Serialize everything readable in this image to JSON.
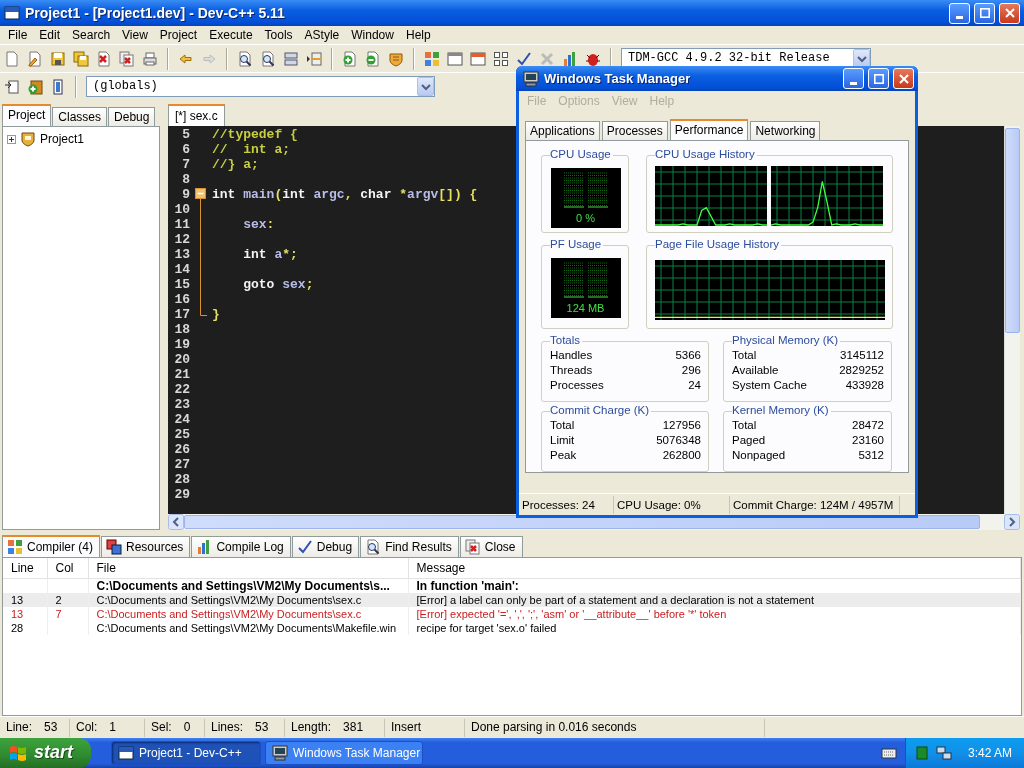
{
  "window": {
    "title": "Project1 - [Project1.dev] - Dev-C++ 5.11"
  },
  "menu": [
    {
      "label": "File"
    },
    {
      "label": "Edit"
    },
    {
      "label": "Search"
    },
    {
      "label": "View"
    },
    {
      "label": "Project"
    },
    {
      "label": "Execute"
    },
    {
      "label": "Tools"
    },
    {
      "label": "AStyle"
    },
    {
      "label": "Window"
    },
    {
      "label": "Help"
    }
  ],
  "compiler_field": {
    "value": "TDM-GCC 4.9.2 32-bit Release"
  },
  "scope_field": {
    "value": "(globals)"
  },
  "side_tabs": [
    {
      "label": "Project",
      "selected": true
    },
    {
      "label": "Classes",
      "selected": false
    },
    {
      "label": "Debug",
      "selected": false
    }
  ],
  "project_tree": [
    {
      "label": "Project1",
      "expanded": false
    }
  ],
  "editor_tabs": [
    {
      "label": "[*] sex.c",
      "selected": true
    }
  ],
  "code_lines": [
    {
      "number": "5",
      "tokens": [
        {
          "text": "//typedef {",
          "kind": "comment"
        }
      ]
    },
    {
      "number": "6",
      "tokens": [
        {
          "text": "//  int a;",
          "kind": "comment"
        }
      ]
    },
    {
      "number": "7",
      "tokens": [
        {
          "text": "//} a;",
          "kind": "comment"
        }
      ]
    },
    {
      "number": "8"
    },
    {
      "number": "9",
      "kind": "fold_start",
      "tokens": [
        {
          "text": "int",
          "kind": "keyword"
        },
        {
          "text": " main",
          "kind": "identifier"
        },
        {
          "text": "(",
          "kind": "symbol"
        },
        {
          "text": "int",
          "kind": "keyword"
        },
        {
          "text": " argc",
          "kind": "identifier"
        },
        {
          "text": ",",
          "kind": "symbol"
        },
        {
          "text": " char",
          "kind": "keyword"
        },
        {
          "text": " *",
          "kind": "symbol"
        },
        {
          "text": "argv",
          "kind": "identifier"
        },
        {
          "text": "[])",
          "kind": "symbol"
        },
        {
          "text": " {",
          "kind": "symbol"
        }
      ]
    },
    {
      "number": "10",
      "kind": "fold_body"
    },
    {
      "number": "11",
      "kind": "fold_body",
      "tokens": [
        {
          "text": "    sex",
          "kind": "identifier"
        },
        {
          "text": ":",
          "kind": "symbol"
        }
      ]
    },
    {
      "number": "12",
      "kind": "fold_body"
    },
    {
      "number": "13",
      "kind": "fold_body",
      "tokens": [
        {
          "text": "    int",
          "kind": "keyword"
        },
        {
          "text": " a",
          "kind": "identifier"
        },
        {
          "text": "*;",
          "kind": "symbol"
        }
      ]
    },
    {
      "number": "14",
      "kind": "fold_body"
    },
    {
      "number": "15",
      "kind": "fold_body",
      "tokens": [
        {
          "text": "    goto",
          "kind": "keyword"
        },
        {
          "text": " sex",
          "kind": "identifier"
        },
        {
          "text": ";",
          "kind": "symbol"
        }
      ]
    },
    {
      "number": "16",
      "kind": "fold_body"
    },
    {
      "number": "17",
      "kind": "fold_end",
      "tokens": [
        {
          "text": "}",
          "kind": "symbol"
        }
      ]
    },
    {
      "number": "18"
    },
    {
      "number": "19"
    },
    {
      "number": "20"
    },
    {
      "number": "21"
    },
    {
      "number": "22"
    },
    {
      "number": "23"
    },
    {
      "number": "24"
    },
    {
      "number": "25"
    },
    {
      "number": "26"
    },
    {
      "number": "27"
    },
    {
      "number": "28"
    },
    {
      "number": "29"
    }
  ],
  "output_tabs": [
    {
      "label": "Compiler (4)",
      "kind": "compiler",
      "selected": true
    },
    {
      "label": "Resources",
      "kind": "resources",
      "selected": false
    },
    {
      "label": "Compile Log",
      "kind": "log",
      "selected": false
    },
    {
      "label": "Debug",
      "kind": "debug",
      "selected": false
    },
    {
      "label": "Find Results",
      "kind": "find",
      "selected": false
    },
    {
      "label": "Close",
      "kind": "close",
      "selected": false
    }
  ],
  "output_table": {
    "columns": [
      "Line",
      "Col",
      "File",
      "Message"
    ],
    "rows": [
      {
        "kind": "header",
        "selected": false,
        "file": "C:\\Documents and Settings\\VM2\\My Documents\\s...",
        "message": "In function 'main':"
      },
      {
        "kind": "normal",
        "selected": true,
        "line": "13",
        "col": "2",
        "file": "C:\\Documents and Settings\\VM2\\My Documents\\sex.c",
        "message": "[Error] a label can only be part of a statement and a declaration is not a statement"
      },
      {
        "kind": "error",
        "selected": false,
        "line": "13",
        "col": "7",
        "file": "C:\\Documents and Settings\\VM2\\My Documents\\sex.c",
        "message": "[Error] expected '=', ',', ';', 'asm' or '__attribute__' before '*' token"
      },
      {
        "kind": "normal",
        "selected": false,
        "line": "28",
        "file": "C:\\Documents and Settings\\VM2\\My Documents\\Makefile.win",
        "message": "recipe for target 'sex.o' failed"
      }
    ]
  },
  "status_bar": [
    {
      "label": "Line:",
      "value": "53"
    },
    {
      "label": "Col:",
      "value": "1"
    },
    {
      "label": "Sel:",
      "value": "0"
    },
    {
      "label": "Lines:",
      "value": "53"
    },
    {
      "label": "Length:",
      "value": "381"
    },
    {
      "value": "Insert"
    },
    {
      "value": "Done parsing in 0.016 seconds"
    }
  ],
  "task_manager": {
    "title": "Windows Task Manager",
    "menu": [
      {
        "label": "File",
        "disabled": true
      },
      {
        "label": "Options",
        "disabled": true
      },
      {
        "label": "View",
        "disabled": true
      },
      {
        "label": "Help",
        "disabled": true
      }
    ],
    "tabs": [
      {
        "label": "Applications",
        "selected": false
      },
      {
        "label": "Processes",
        "selected": false
      },
      {
        "label": "Performance",
        "selected": true
      },
      {
        "label": "Networking",
        "selected": false
      }
    ],
    "cpu_usage": {
      "title": "CPU Usage",
      "reading": "0 %"
    },
    "cpu_history": {
      "title": "CPU Usage History"
    },
    "pf_usage": {
      "title": "PF Usage",
      "reading": "124 MB"
    },
    "pf_history": {
      "title": "Page File Usage History"
    },
    "groups": [
      {
        "title": "Totals",
        "rows": [
          {
            "label": "Handles",
            "value": "5366"
          },
          {
            "label": "Threads",
            "value": "296"
          },
          {
            "label": "Processes",
            "value": "24"
          }
        ]
      },
      {
        "title": "Physical Memory (K)",
        "rows": [
          {
            "label": "Total",
            "value": "3145112"
          },
          {
            "label": "Available",
            "value": "2829252"
          },
          {
            "label": "System Cache",
            "value": "433928"
          }
        ]
      },
      {
        "title": "Commit Charge (K)",
        "rows": [
          {
            "label": "Total",
            "value": "127956"
          },
          {
            "label": "Limit",
            "value": "5076348"
          },
          {
            "label": "Peak",
            "value": "262800"
          }
        ]
      },
      {
        "title": "Kernel Memory (K)",
        "rows": [
          {
            "label": "Total",
            "value": "28472"
          },
          {
            "label": "Paged",
            "value": "23160"
          },
          {
            "label": "Nonpaged",
            "value": "5312"
          }
        ]
      }
    ],
    "status_bar": [
      "Processes: 24",
      "CPU Usage: 0%",
      "Commit Charge: 124M / 4957M"
    ]
  },
  "taskbar": {
    "start": "start",
    "tasks": [
      {
        "label": "Project1 - Dev-C++",
        "kind": "ide",
        "selected": true
      },
      {
        "label": "Windows Task Manager",
        "kind": "monitor",
        "selected": false
      }
    ],
    "clock": "3:42 AM"
  }
}
